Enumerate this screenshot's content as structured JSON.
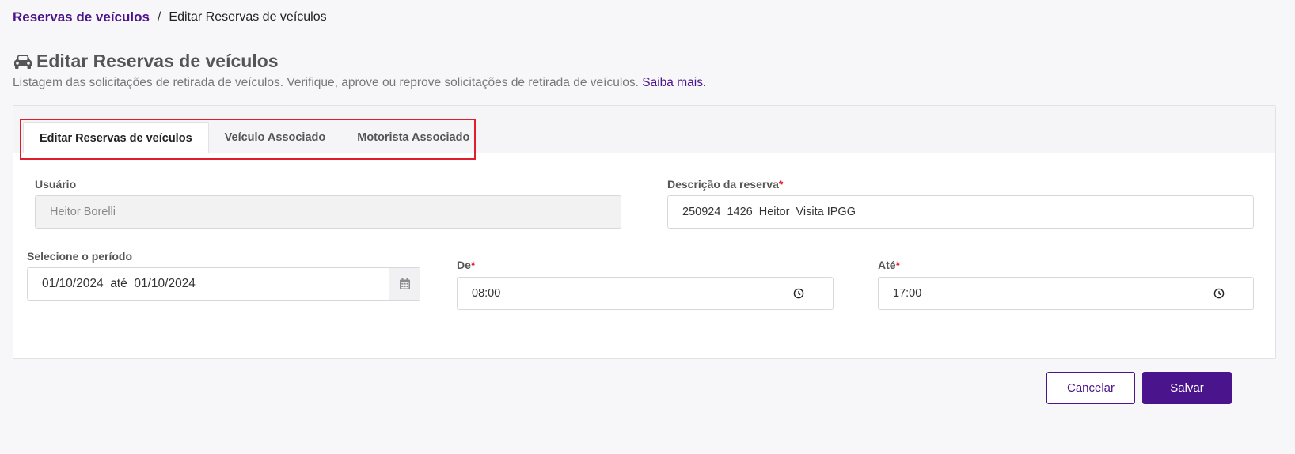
{
  "breadcrumb": {
    "parent": "Reservas de veículos",
    "separator": "/",
    "current": "Editar Reservas de veículos"
  },
  "header": {
    "icon": "car-icon",
    "title": "Editar Reservas de veículos",
    "description": "Listagem das solicitações de retirada de veículos. Verifique, aprove ou reprove solicitações de retirada de veículos.",
    "learn_more": "Saiba mais."
  },
  "tabs": [
    {
      "label": "Editar Reservas de veículos",
      "active": true
    },
    {
      "label": "Veículo Associado",
      "active": false
    },
    {
      "label": "Motorista Associado",
      "active": false
    }
  ],
  "form": {
    "usuario": {
      "label": "Usuário",
      "value": "Heitor Borelli"
    },
    "descricao": {
      "label": "Descrição da reserva",
      "required_mark": "*",
      "value": "250924  1426  Heitor  Visita IPGG"
    },
    "periodo": {
      "label": "Selecione o período",
      "value": "01/10/2024  até  01/10/2024"
    },
    "de": {
      "label": "De",
      "required_mark": "*",
      "value": "08:00"
    },
    "ate": {
      "label": "Até",
      "required_mark": "*",
      "value": "17:00"
    }
  },
  "actions": {
    "cancel_label": "Cancelar",
    "save_label": "Salvar"
  },
  "colors": {
    "accent": "#4a148c",
    "required": "#e01e2b",
    "highlight": "#e01e2b"
  }
}
